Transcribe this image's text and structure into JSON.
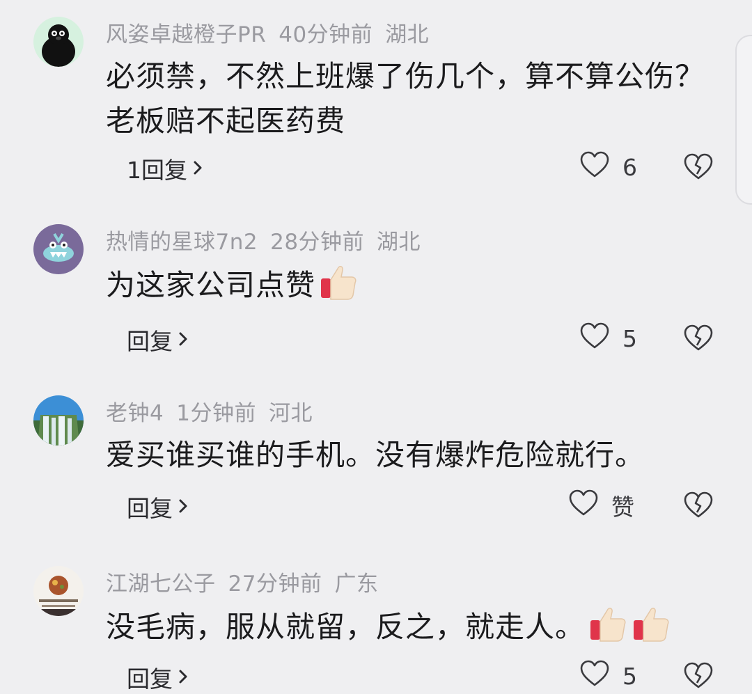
{
  "comments": [
    {
      "username": "风姿卓越橙子PR",
      "time": "40分钟前",
      "location": "湖北",
      "text": "必须禁，不然上班爆了伤几个，算不算公伤？老板赔不起医药费",
      "reply_label": "1回复",
      "likes": "6",
      "avatar_icon": "penguin-avatar-icon",
      "emoji": []
    },
    {
      "username": "热情的星球7n2",
      "time": "28分钟前",
      "location": "湖北",
      "text": "为这家公司点赞",
      "reply_label": "回复",
      "likes": "5",
      "avatar_icon": "cartoon-monster-avatar-icon",
      "emoji": [
        "thumbs-up-icon"
      ]
    },
    {
      "username": "老钟4",
      "time": "1分钟前",
      "location": "河北",
      "text": "爱买谁买谁的手机。没有爆炸危险就行。",
      "reply_label": "回复",
      "likes": "赞",
      "avatar_icon": "waterfall-avatar-icon",
      "emoji": []
    },
    {
      "username": "江湖七公子",
      "time": "27分钟前",
      "location": "广东",
      "text": "没毛病，服从就留，反之，就走人。",
      "reply_label": "回复",
      "likes": "5",
      "avatar_icon": "food-avatar-icon",
      "emoji": [
        "thumbs-up-icon",
        "thumbs-up-icon"
      ]
    }
  ],
  "icons": {
    "like": "heart-outline-icon",
    "dislike": "broken-heart-icon",
    "reply_arrow": "chevron-right-icon"
  }
}
